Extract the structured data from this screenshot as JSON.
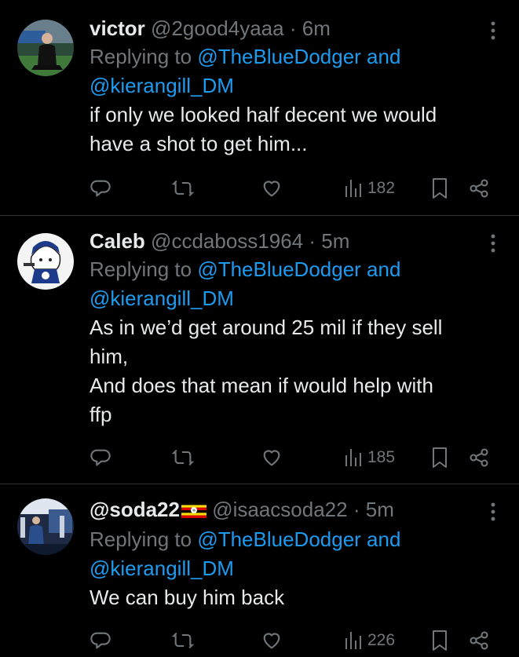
{
  "tweets": [
    {
      "name": "victor",
      "handle": "@2good4yaaa",
      "dot": "·",
      "time": "6m",
      "reply_prefix": "Replying to",
      "mention1": "@TheBlueDodger and",
      "mention2": "@kierangill_DM",
      "text": "if only we looked half decent we would\nhave a shot to get him...",
      "views": "182"
    },
    {
      "name": "Caleb",
      "handle": "@ccdaboss1964",
      "dot": "·",
      "time": "5m",
      "reply_prefix": "Replying to",
      "mention1": "@TheBlueDodger and",
      "mention2": "@kierangill_DM",
      "text": "As in we’d get around 25 mil if they sell\nhim,\nAnd does that mean if would help with\nffp",
      "views": "185"
    },
    {
      "name": "@soda22",
      "handle": "@isaacsoda22",
      "dot": "·",
      "time": "5m",
      "reply_prefix": "Replying to",
      "mention1": "@TheBlueDodger and",
      "mention2": "@kierangill_DM",
      "text": "We can buy him back",
      "views": "226"
    }
  ],
  "icons": [
    "reply-icon",
    "retweet-icon",
    "like-icon",
    "views-icon",
    "bookmark-icon",
    "share-icon",
    "more-icon",
    "uganda-flag-icon"
  ],
  "colors": {
    "background": "#000000",
    "text": "#e7e9ea",
    "muted": "#71767b",
    "link": "#1d9bf0",
    "divider": "#2f3336"
  }
}
